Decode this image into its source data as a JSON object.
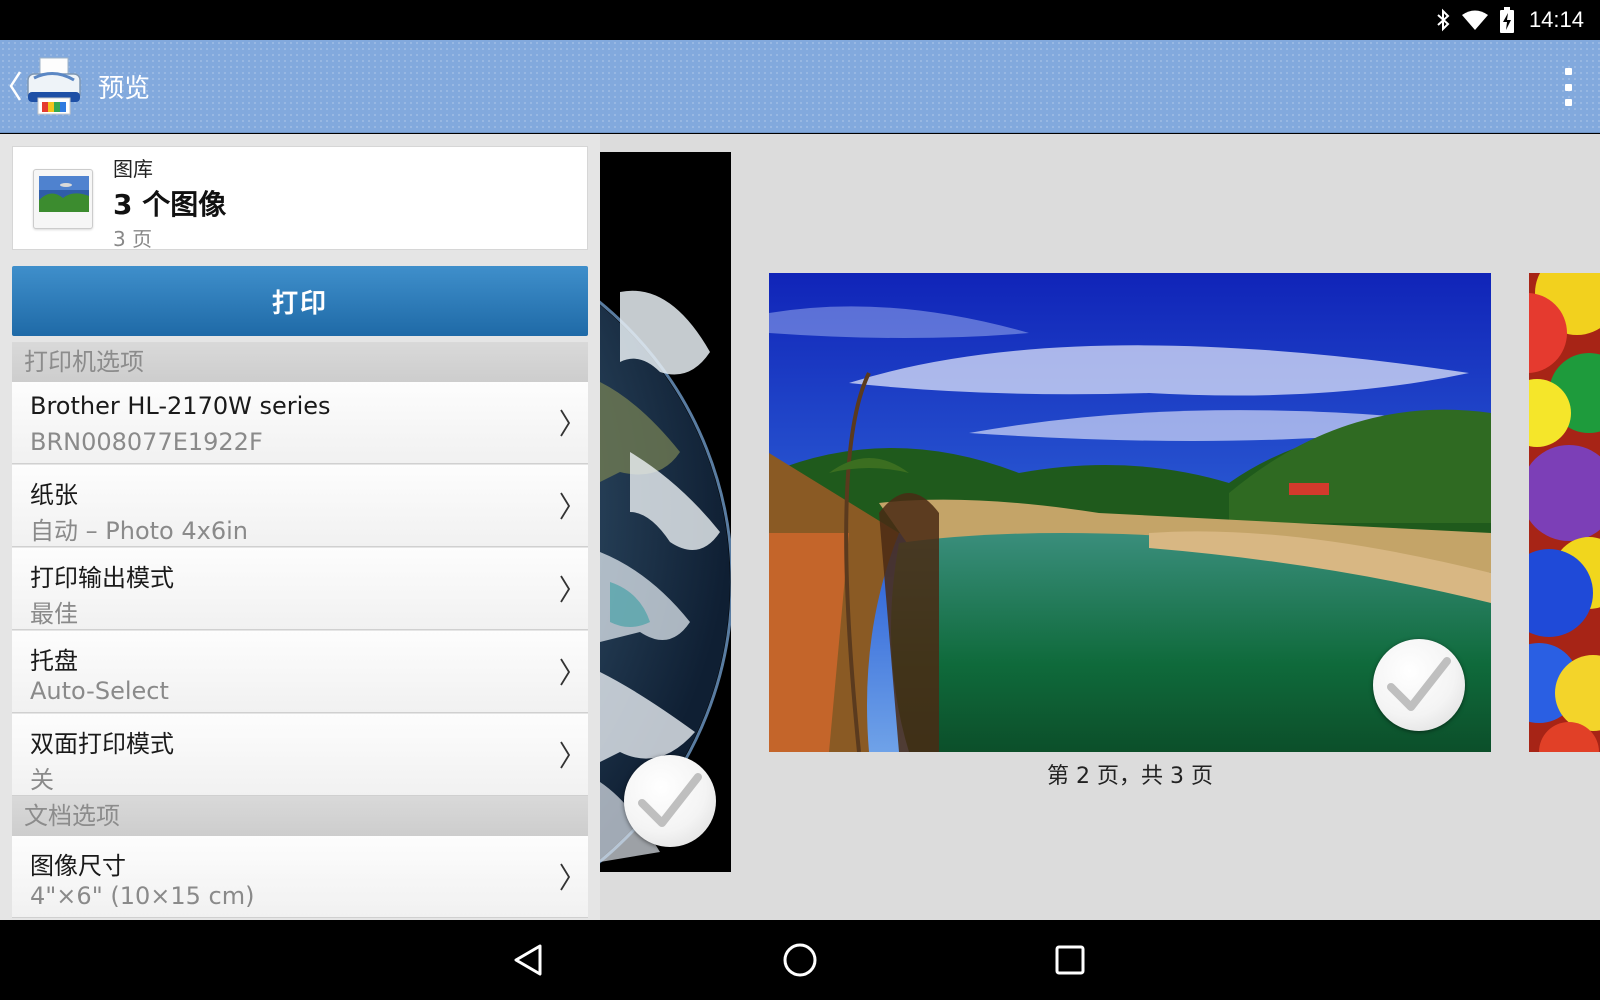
{
  "status_bar": {
    "time": "14:14",
    "icons": [
      "bluetooth-icon",
      "wifi-icon",
      "battery-charging-icon"
    ]
  },
  "app_bar": {
    "title": "预览",
    "back_icon": "chevron-left-icon",
    "logo_icon": "printer-app-logo",
    "menu_icon": "overflow-menu-icon"
  },
  "source": {
    "label": "图库",
    "title": "3 个图像",
    "pages": "3 页",
    "icon": "gallery-image-icon"
  },
  "print_button": {
    "label": "打印"
  },
  "printer_options": {
    "header": "打印机选项",
    "items": [
      {
        "title": "Brother HL-2170W series",
        "value": "BRN008077E1922F"
      },
      {
        "title": "纸张",
        "value": "自动 – Photo 4x6in"
      },
      {
        "title": "打印输出模式",
        "value": "最佳"
      },
      {
        "title": "托盘",
        "value": "Auto-Select"
      },
      {
        "title": "双面打印模式",
        "value": "关"
      }
    ]
  },
  "document_options": {
    "header": "文档选项",
    "items": [
      {
        "title": "图像尺寸",
        "value": "4\"×6\" (10×15 cm)"
      }
    ]
  },
  "preview": {
    "caption": "第 2 页，共 3 页",
    "pages": [
      "earth-photo",
      "river-photo",
      "colored-balls-photo"
    ]
  },
  "nav_bar": {
    "icons": [
      "nav-back-icon",
      "nav-home-icon",
      "nav-recents-icon"
    ]
  },
  "colors": {
    "app_bar": "#82a9dd",
    "print_button": "#2a7bbd",
    "panel_bg": "#e5e5e5",
    "preview_bg": "#dcdcdc"
  }
}
